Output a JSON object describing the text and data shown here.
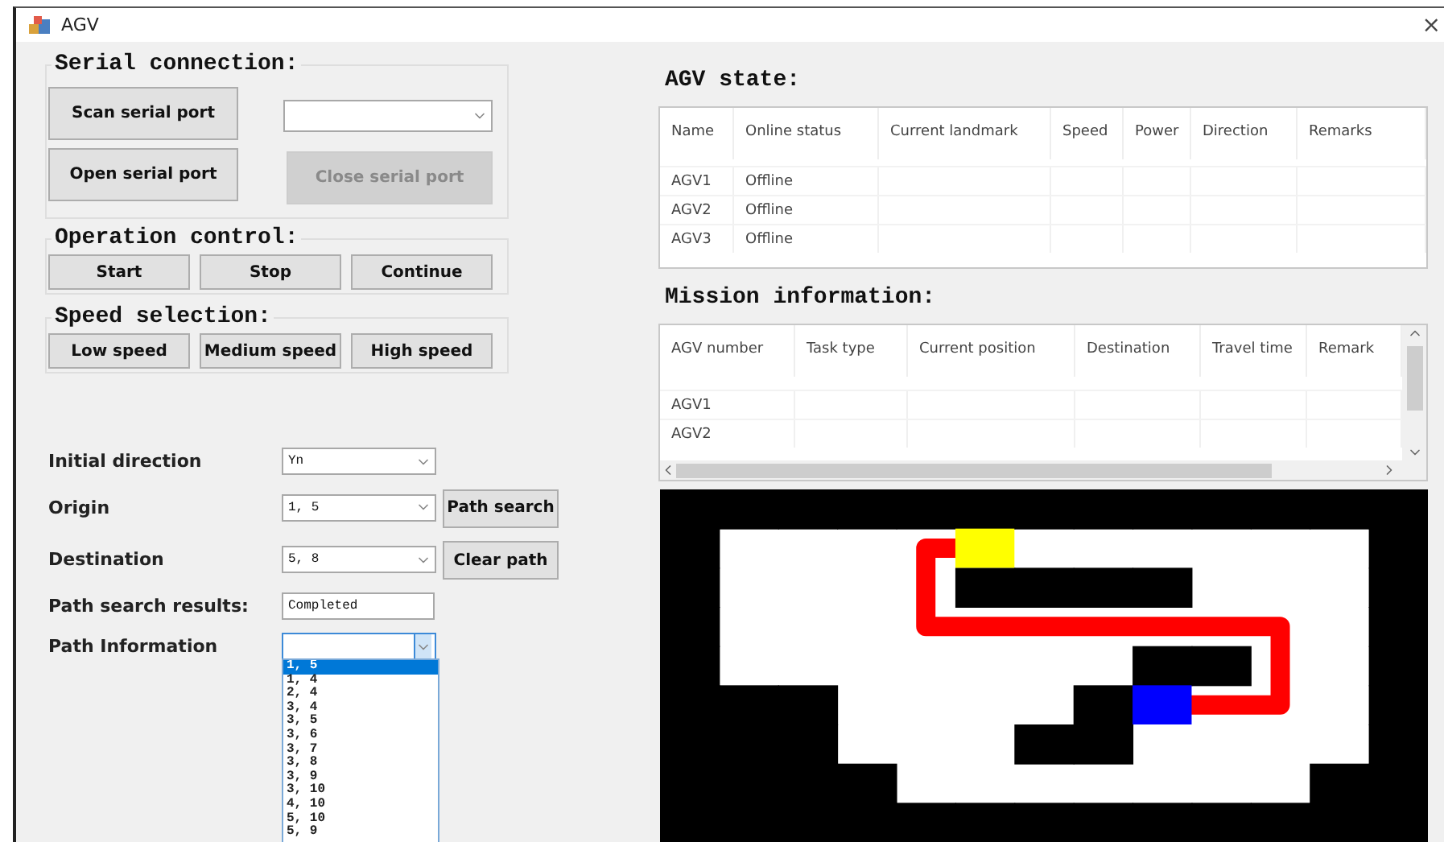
{
  "window": {
    "title": "AGV",
    "close": "×"
  },
  "serial_connection": {
    "title": "Serial connection:",
    "buttons": [
      {
        "label": "Scan serial port",
        "disabled": false
      },
      {
        "label": "Open serial port",
        "disabled": false
      },
      {
        "label": "Close serial port",
        "disabled": true
      }
    ]
  },
  "operation_control": {
    "title": "Operation control:",
    "buttons": [
      {
        "label": "Start"
      },
      {
        "label": "Stop"
      },
      {
        "label": "Continue"
      }
    ]
  },
  "speed_selection": {
    "title": "Speed selection:",
    "buttons": [
      {
        "label": "Low speed"
      },
      {
        "label": "Medium speed"
      },
      {
        "label": "High speed"
      }
    ]
  },
  "path_form": {
    "fields": [
      {
        "label": "Initial direction",
        "kind": "combo",
        "value": "Yn"
      },
      {
        "label": "Origin",
        "kind": "combo",
        "value": "1, 5"
      },
      {
        "label": "Destination",
        "kind": "combo",
        "value": "5, 8"
      },
      {
        "label": "Path search results:",
        "kind": "text",
        "value": "Completed"
      },
      {
        "label": "Path Information",
        "kind": "combo",
        "expanded": true
      }
    ],
    "buttons": [
      {
        "label": "Path search"
      },
      {
        "label": "Clear path"
      }
    ],
    "path_list": [
      {
        "text": "1, 5",
        "selected": true
      },
      {
        "text": "1, 4",
        "selected": false
      },
      {
        "text": "2, 4",
        "selected": false
      },
      {
        "text": "3, 4",
        "selected": false
      },
      {
        "text": "3, 5",
        "selected": false
      },
      {
        "text": "3, 6",
        "selected": false
      },
      {
        "text": "3, 7",
        "selected": false
      },
      {
        "text": "3, 8",
        "selected": false
      },
      {
        "text": "3, 9",
        "selected": false
      },
      {
        "text": "3, 10",
        "selected": false
      },
      {
        "text": "4, 10",
        "selected": false
      },
      {
        "text": "5, 10",
        "selected": false
      },
      {
        "text": "5, 9",
        "selected": false
      }
    ]
  },
  "agv_state": {
    "title": "AGV state:",
    "columns": [
      "Name",
      "Online status",
      "Current landmark",
      "Speed",
      "Power",
      "Direction",
      "Remarks"
    ],
    "rows": [
      [
        "AGV1",
        "Offline"
      ],
      [
        "AGV2",
        "Offline"
      ],
      [
        "AGV3",
        "Offline"
      ]
    ]
  },
  "mission_information": {
    "title": "Mission information:",
    "columns": [
      "AGV number",
      "Task type",
      "Current position",
      "Destination",
      "Travel time",
      "Remark"
    ],
    "rows": [
      [
        "AGV1"
      ],
      [
        "AGV2"
      ]
    ]
  }
}
